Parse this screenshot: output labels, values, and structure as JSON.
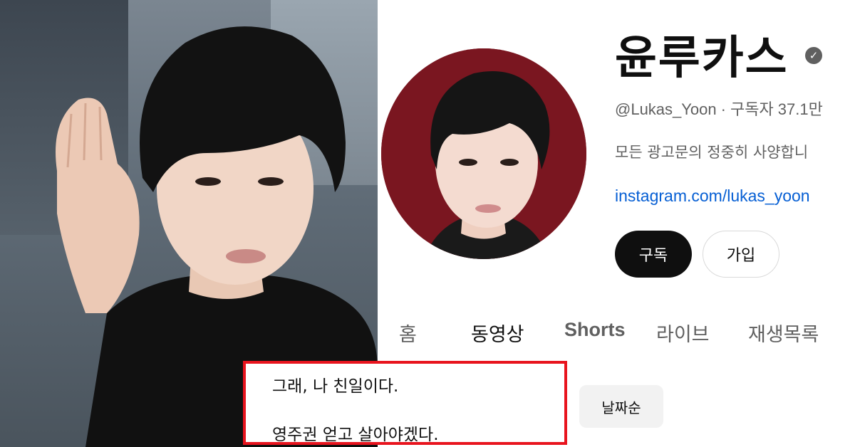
{
  "channel": {
    "name": "윤루카스",
    "handle": "@Lukas_Yoon",
    "separator": "·",
    "subscribers": "구독자 37.1만",
    "description": "모든 광고문의 정중히 사양합니",
    "link": "instagram.com/lukas_yoon",
    "verified_icon": "verified-check-icon"
  },
  "buttons": {
    "subscribe": "구독",
    "join": "가입"
  },
  "tabs": [
    {
      "label": "홈"
    },
    {
      "label": "동영상"
    },
    {
      "label": "Shorts"
    },
    {
      "label": "라이브"
    },
    {
      "label": "재생목록"
    }
  ],
  "sort_chip": "날짜순",
  "caption": {
    "line1": "그래, 나 친일이다.",
    "line2": "영주권 얻고 살아야겠다."
  },
  "colors": {
    "caption_border": "#e8141e",
    "subscribe_bg": "#0f0f0f",
    "link": "#065fd4",
    "avatar_bg": "#7a1620"
  }
}
